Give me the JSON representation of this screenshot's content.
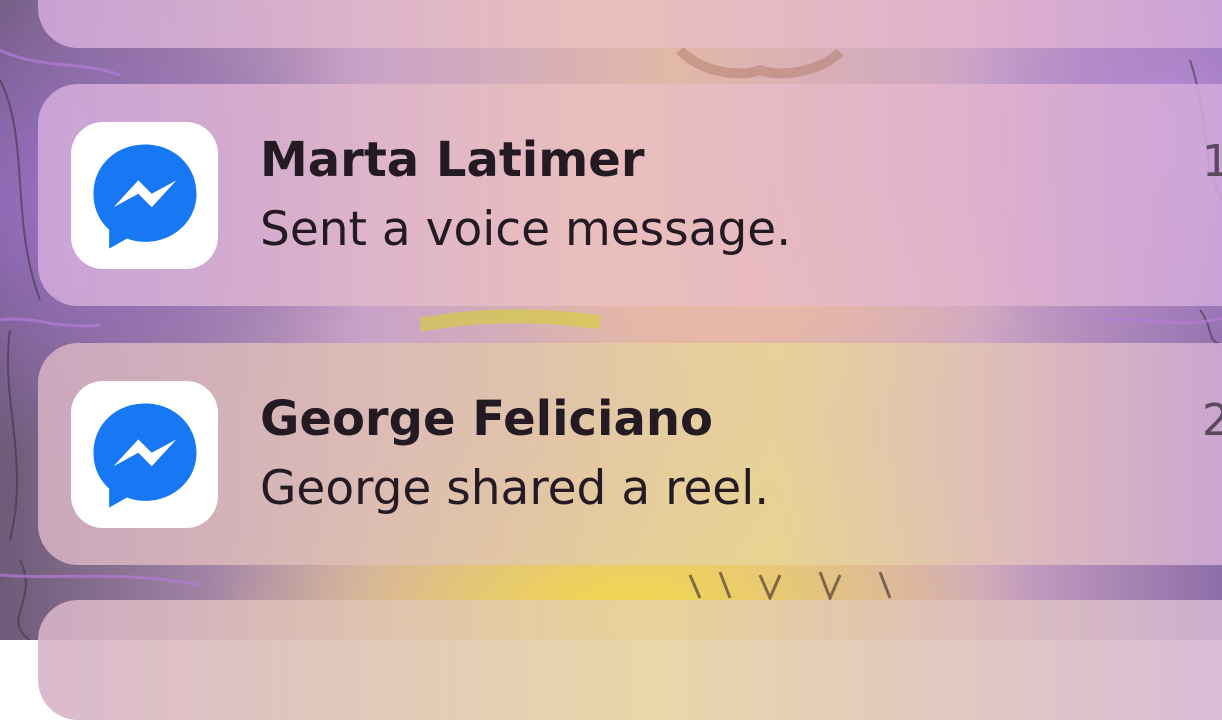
{
  "colors": {
    "messenger_blue": "#1877f2",
    "text_primary": "#231a24",
    "timestamp_text": "#5a4a5c"
  },
  "notifications": [
    {
      "app_icon": "messenger-icon",
      "sender": "Marta Latimer",
      "message": "Sent a voice message.",
      "time": "1"
    },
    {
      "app_icon": "messenger-icon",
      "sender": "George Feliciano",
      "message": "George shared a reel.",
      "time": "2"
    }
  ]
}
